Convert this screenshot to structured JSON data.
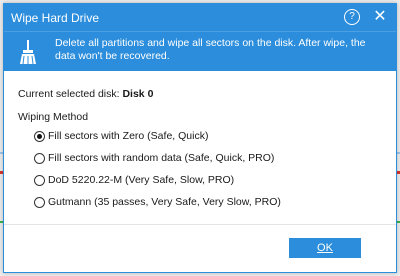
{
  "window": {
    "title": "Wipe Hard Drive",
    "help_icon": "help-circle-icon",
    "close_icon": "close-icon",
    "help_glyph": "?",
    "close_glyph": "✕"
  },
  "banner": {
    "icon": "broom-icon",
    "text": "Delete all partitions and wipe all sectors on the disk. After wipe, the data won't be recovered."
  },
  "disk": {
    "label": "Current selected disk:",
    "value": "Disk 0"
  },
  "method": {
    "label": "Wiping Method",
    "options": [
      {
        "label": "Fill sectors with Zero (Safe, Quick)",
        "selected": true
      },
      {
        "label": "Fill sectors with random data (Safe, Quick, PRO)",
        "selected": false
      },
      {
        "label": "DoD 5220.22-M (Very Safe, Slow, PRO)",
        "selected": false
      },
      {
        "label": "Gutmann (35 passes, Very Safe, Very Slow, PRO)",
        "selected": false
      }
    ]
  },
  "footer": {
    "ok_label": "OK"
  },
  "colors": {
    "accent": "#2b8ddb"
  }
}
